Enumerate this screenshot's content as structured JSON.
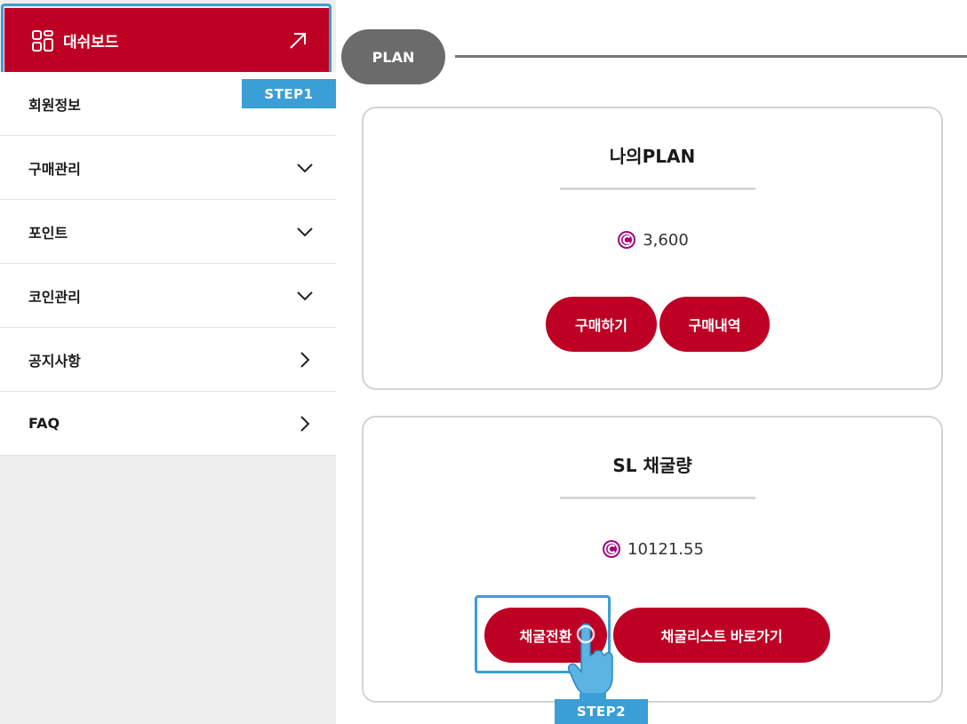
{
  "sidebar": {
    "active": {
      "label": "대쉬보드",
      "icon": "dashboard-grid-icon",
      "action_icon": "external-arrow-icon"
    },
    "items": [
      {
        "label": "회원정보",
        "icon": "chevron-down-icon"
      },
      {
        "label": "구매관리",
        "icon": "chevron-down-icon"
      },
      {
        "label": "포인트",
        "icon": "chevron-down-icon"
      },
      {
        "label": "코인관리",
        "icon": "chevron-down-icon"
      },
      {
        "label": "공지사항",
        "icon": "chevron-right-icon"
      },
      {
        "label": "FAQ",
        "icon": "chevron-right-icon"
      }
    ]
  },
  "annotations": {
    "step1": "STEP1",
    "step2": "STEP2"
  },
  "main": {
    "section_label": "PLAN",
    "cards": [
      {
        "title": "나의PLAN",
        "value": "3,600",
        "buttons": [
          "구매하기",
          "구매내역"
        ]
      },
      {
        "title": "SL 채굴량",
        "value": "10121.55",
        "buttons": [
          "채굴전환",
          "채굴리스트 바로가기"
        ]
      }
    ]
  },
  "colors": {
    "brand_red": "#be0024",
    "step_blue": "#3a9fd6",
    "coin_purple": "#a3007f",
    "pill_gray": "#6b6b6b"
  }
}
